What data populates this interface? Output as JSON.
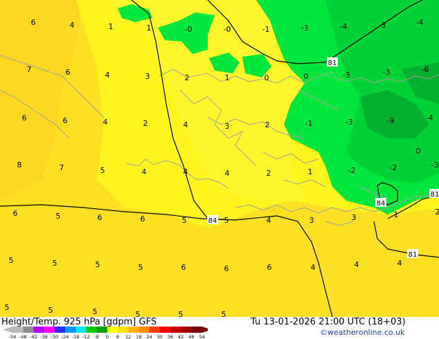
{
  "footer": {
    "title": "Height/Temp. 925 hPa [gdpm] GFS",
    "datetime": "Tu 13-01-2026 21:00 UTC (18+03)",
    "credit": "©weatheronline.co.uk"
  },
  "scale": {
    "ticks": [
      "-54",
      "-48",
      "-42",
      "-38",
      "-30",
      "-24",
      "-18",
      "-12",
      "-8",
      "0",
      "8",
      "12",
      "18",
      "24",
      "30",
      "36",
      "42",
      "48",
      "54"
    ],
    "colors": [
      "#b9b9b9",
      "#8f8f8f",
      "#b400ff",
      "#ff00ff",
      "#2a2aff",
      "#0096ff",
      "#00e6ff",
      "#00c800",
      "#00a000",
      "#ffff00",
      "#ffe000",
      "#ffb400",
      "#ff8c00",
      "#ff3c00",
      "#ff0000",
      "#c80000",
      "#a00000",
      "#780000"
    ]
  },
  "colors": {
    "warm_yellow": "#fde024",
    "bright_yellow": "#fff51e",
    "light_green": "#00e63c",
    "mid_green": "#00c832",
    "dark_green": "#00a028",
    "coast": "#a0a0a0",
    "contour": "#000000"
  },
  "contours": [
    {
      "label": "81"
    },
    {
      "label": "84"
    },
    {
      "label": "84"
    },
    {
      "label": "81"
    },
    {
      "label": "81"
    }
  ],
  "temp_labels": [
    {
      "text": "6"
    },
    {
      "text": "4"
    },
    {
      "text": "1"
    },
    {
      "text": "1"
    },
    {
      "text": "-0"
    },
    {
      "text": "-0"
    },
    {
      "text": "-1"
    },
    {
      "text": "-3"
    },
    {
      "text": "-4"
    },
    {
      "text": "-3"
    },
    {
      "text": "-4"
    },
    {
      "text": "7"
    },
    {
      "text": "6"
    },
    {
      "text": "4"
    },
    {
      "text": "3"
    },
    {
      "text": "2"
    },
    {
      "text": "1"
    },
    {
      "text": "0"
    },
    {
      "text": "0"
    },
    {
      "text": "-3"
    },
    {
      "text": "-3"
    },
    {
      "text": "-6"
    },
    {
      "text": "6"
    },
    {
      "text": "6"
    },
    {
      "text": "4"
    },
    {
      "text": "2"
    },
    {
      "text": "4"
    },
    {
      "text": "3"
    },
    {
      "text": "2"
    },
    {
      "text": "-1"
    },
    {
      "text": "-3"
    },
    {
      "text": "-9"
    },
    {
      "text": "-4"
    },
    {
      "text": "0"
    },
    {
      "text": "8"
    },
    {
      "text": "7"
    },
    {
      "text": "5"
    },
    {
      "text": "4"
    },
    {
      "text": "4"
    },
    {
      "text": "4"
    },
    {
      "text": "2"
    },
    {
      "text": "1"
    },
    {
      "text": "-2"
    },
    {
      "text": "-2"
    },
    {
      "text": "-3"
    },
    {
      "text": "6"
    },
    {
      "text": "5"
    },
    {
      "text": "6"
    },
    {
      "text": "6"
    },
    {
      "text": "5"
    },
    {
      "text": "5"
    },
    {
      "text": "4"
    },
    {
      "text": "3"
    },
    {
      "text": "3"
    },
    {
      "text": "1"
    },
    {
      "text": "2"
    },
    {
      "text": "5"
    },
    {
      "text": "5"
    },
    {
      "text": "5"
    },
    {
      "text": "5"
    },
    {
      "text": "6"
    },
    {
      "text": "6"
    },
    {
      "text": "6"
    },
    {
      "text": "4"
    },
    {
      "text": "4"
    },
    {
      "text": "4"
    },
    {
      "text": "5"
    },
    {
      "text": "5"
    },
    {
      "text": "5"
    },
    {
      "text": "5"
    },
    {
      "text": "5"
    },
    {
      "text": "5"
    }
  ]
}
